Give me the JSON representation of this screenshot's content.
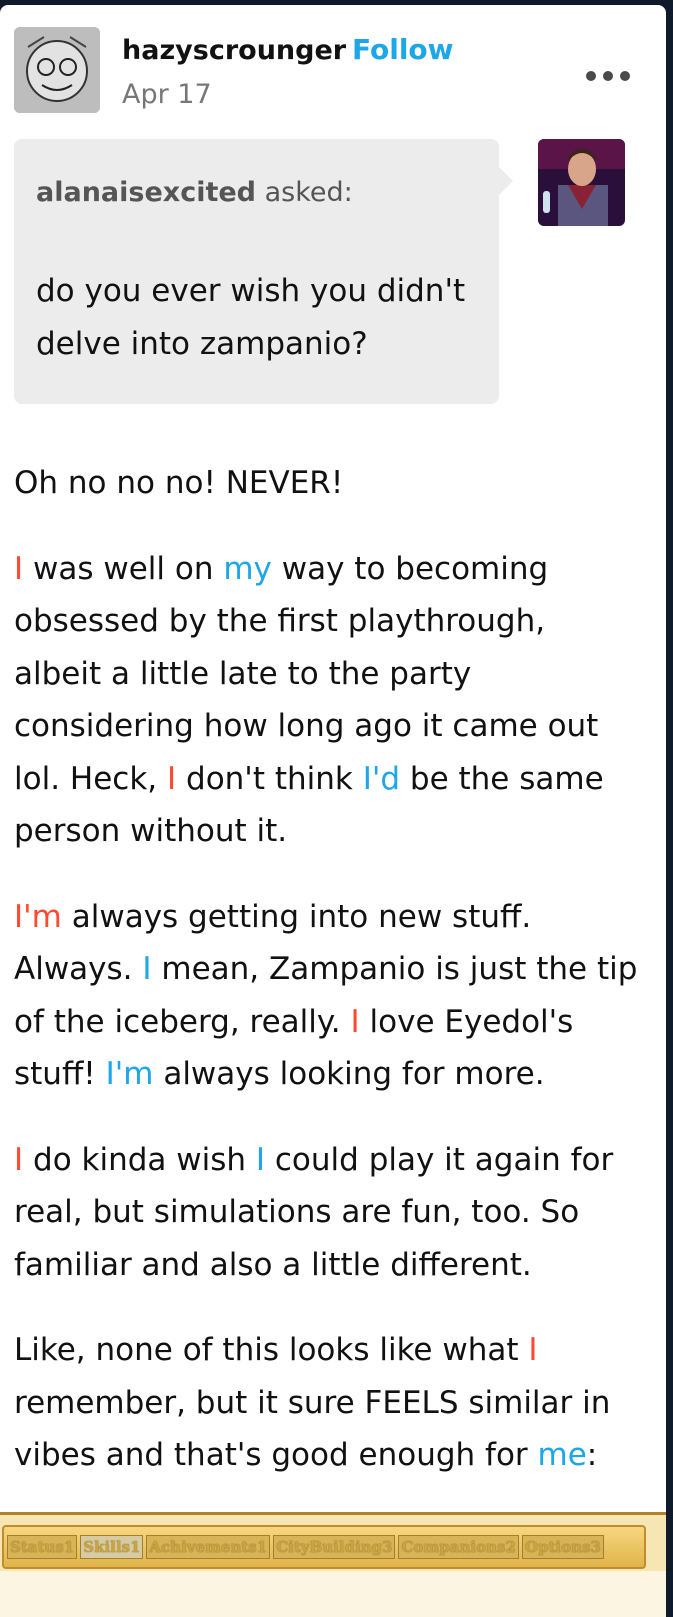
{
  "post": {
    "username": "hazyscrounger",
    "follow_label": "Follow",
    "date": "Apr 17",
    "ask": {
      "asker": "alanaisexcited",
      "asked_label": "asked:",
      "question": "do you ever wish you didn't delve into zampanio?"
    },
    "paragraphs": [
      [
        {
          "t": "Oh no no no! NEVER!",
          "c": ""
        }
      ],
      [
        {
          "t": "I",
          "c": "red"
        },
        {
          "t": " was well on ",
          "c": ""
        },
        {
          "t": "my",
          "c": "blue"
        },
        {
          "t": " way to becoming obsessed by the first playthrough, albeit a little late to the party considering how long ago it came out lol. Heck, ",
          "c": ""
        },
        {
          "t": "I",
          "c": "red"
        },
        {
          "t": " don't think ",
          "c": ""
        },
        {
          "t": "I'd",
          "c": "blue"
        },
        {
          "t": " be the same person without it.",
          "c": ""
        }
      ],
      [
        {
          "t": "I'm",
          "c": "red"
        },
        {
          "t": " always getting into new stuff. Always. ",
          "c": ""
        },
        {
          "t": "I",
          "c": "blue"
        },
        {
          "t": " mean, Zampanio is just the tip of the iceberg, really. ",
          "c": ""
        },
        {
          "t": "I",
          "c": "red"
        },
        {
          "t": " love Eyedol's stuff! ",
          "c": ""
        },
        {
          "t": "I'm",
          "c": "blue"
        },
        {
          "t": " always looking for more.",
          "c": ""
        }
      ],
      [
        {
          "t": "I",
          "c": "red"
        },
        {
          "t": " do kinda wish ",
          "c": ""
        },
        {
          "t": "I",
          "c": "blue"
        },
        {
          "t": " could play it again for real, but simulations are fun, too. So familiar and also a little different.",
          "c": ""
        }
      ],
      [
        {
          "t": "Like, none of this looks like what ",
          "c": ""
        },
        {
          "t": "I",
          "c": "red"
        },
        {
          "t": " remember, but it sure FEELS similar in vibes and that's good enough for ",
          "c": ""
        },
        {
          "t": "me",
          "c": "blue"
        },
        {
          "t": ":",
          "c": ""
        }
      ]
    ]
  },
  "game_ui": {
    "tabs": [
      "Status1",
      "Skills1",
      "Achivements1",
      "CityBuilding3",
      "Companions2",
      "Options3"
    ],
    "active_tab": "Skills1"
  },
  "icons": {
    "more": "more-options-icon"
  },
  "colors": {
    "link_blue": "#1da6e8",
    "highlight_red": "#ff4930",
    "ask_background": "#ececec"
  }
}
